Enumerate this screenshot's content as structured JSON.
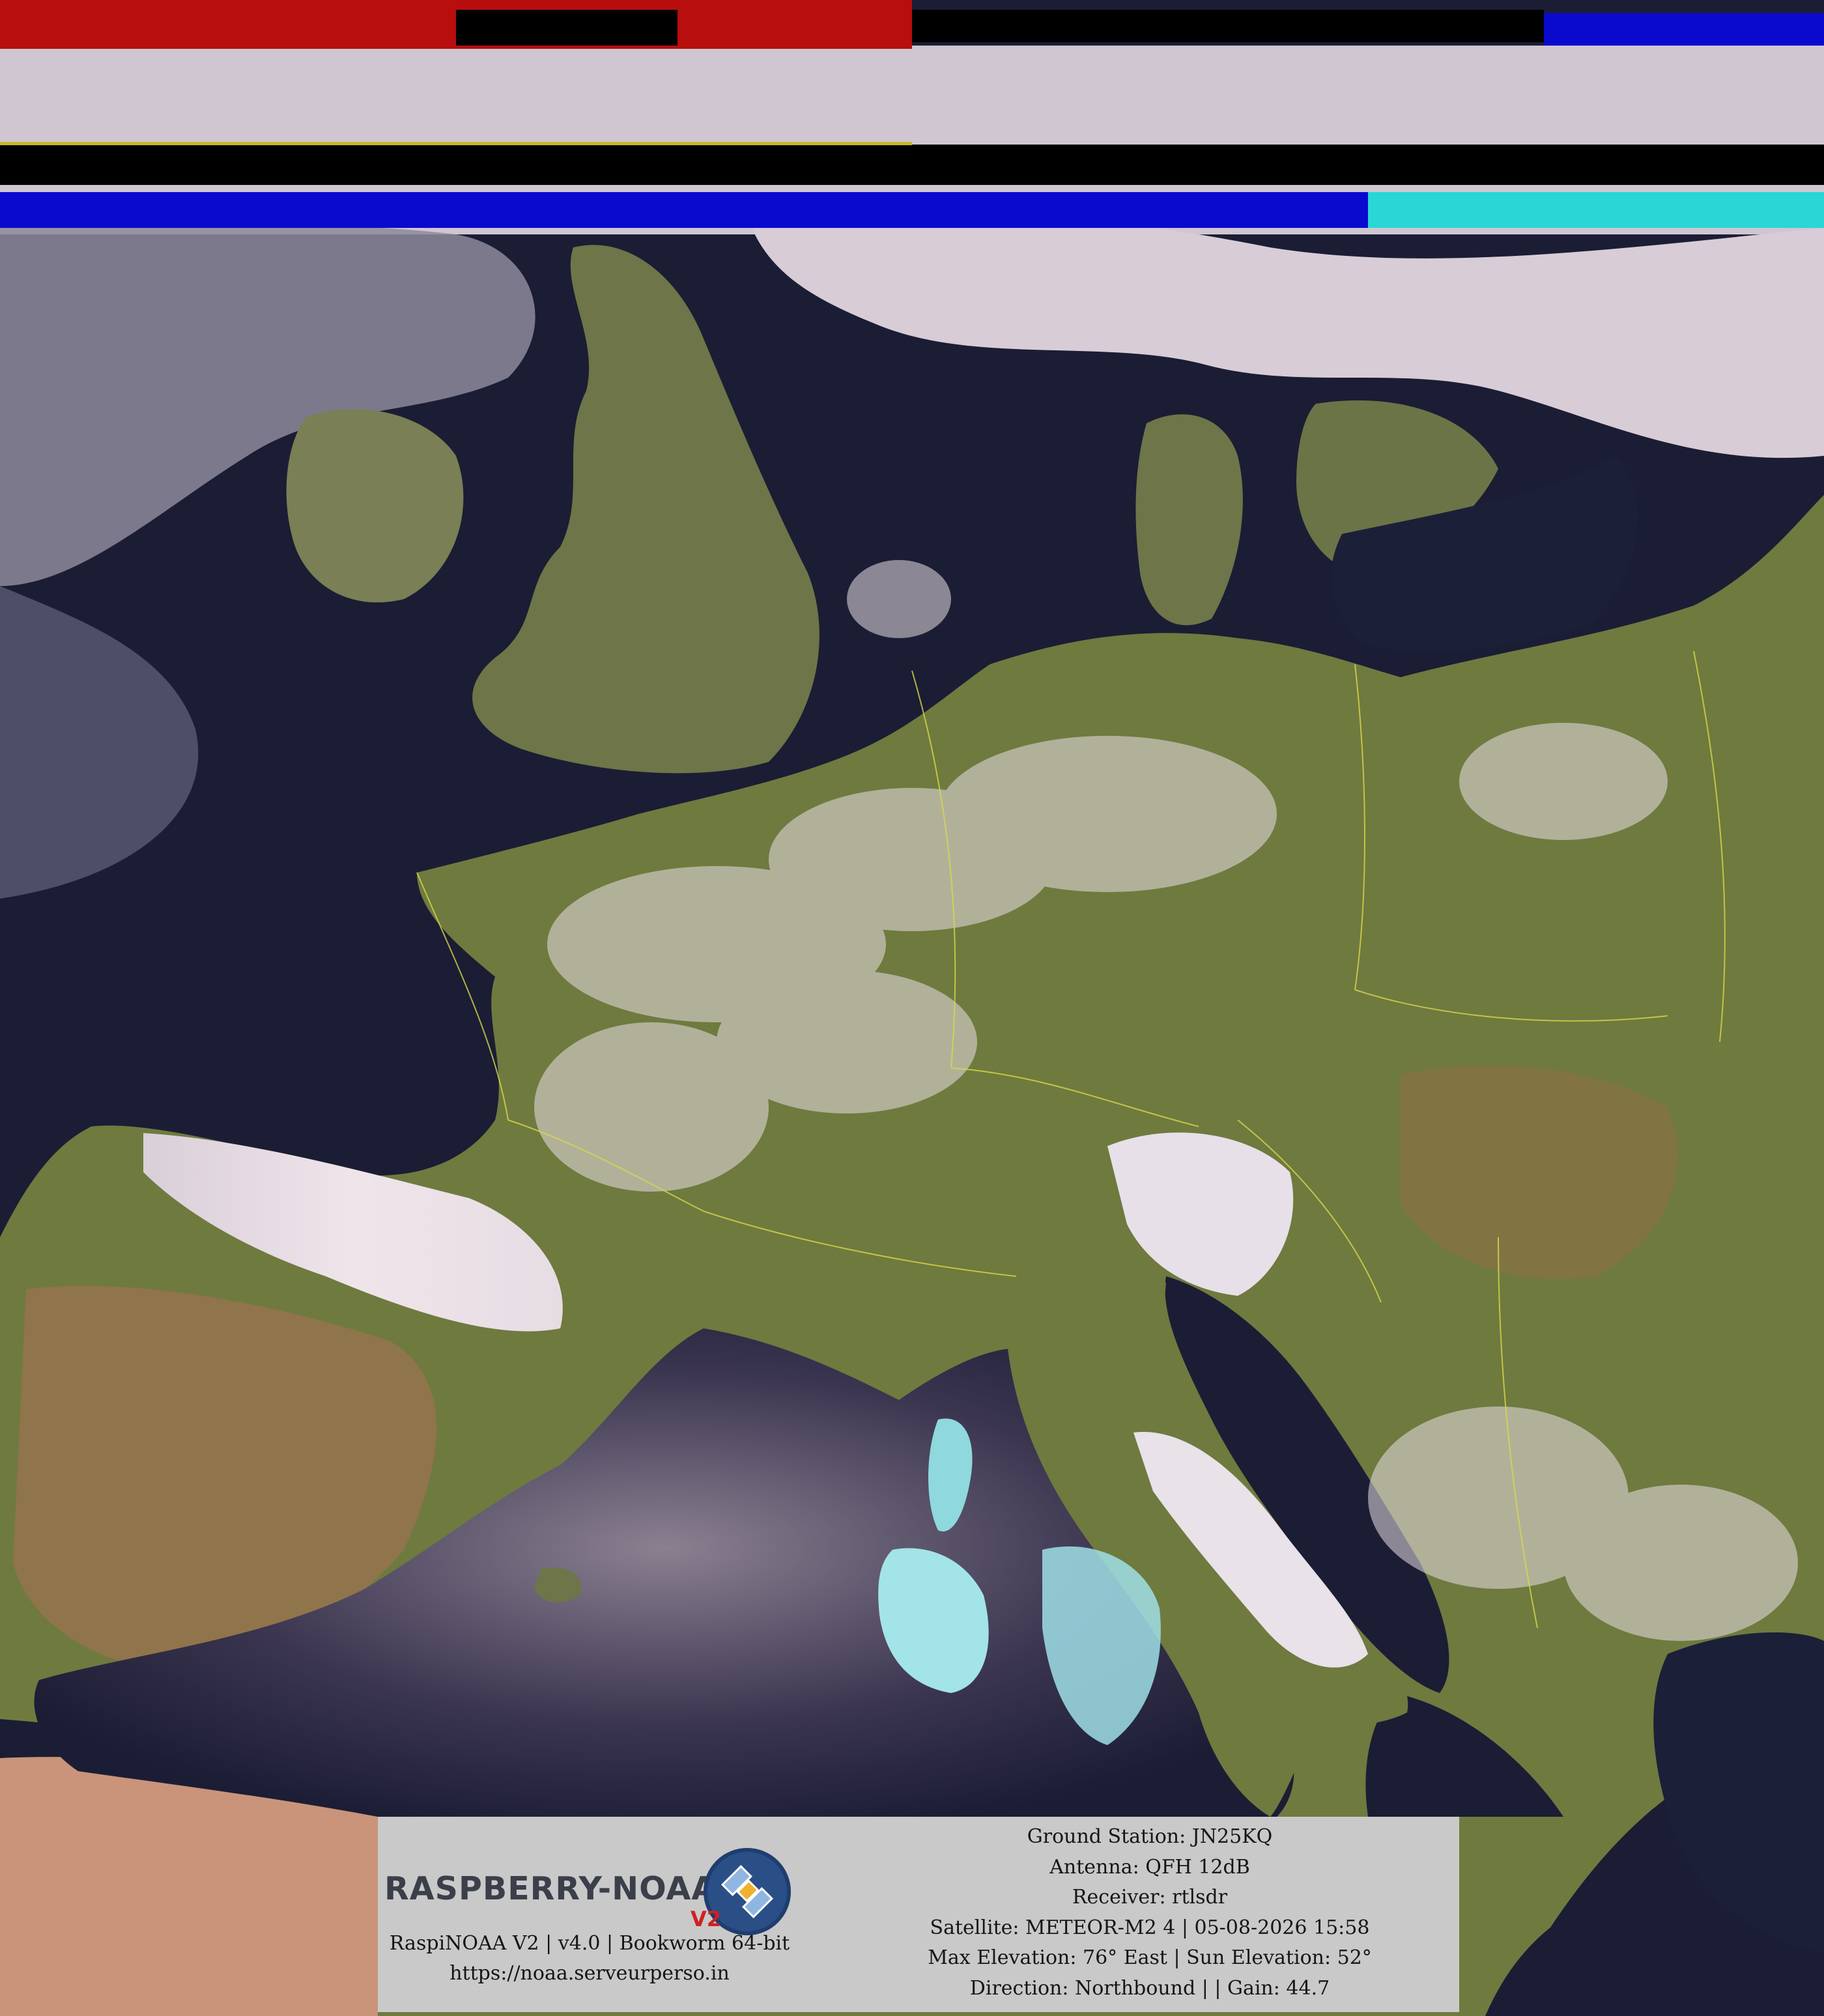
{
  "scene": {
    "description_colors": {
      "sea": "#1b1d34",
      "land_green": "#6b7a3d",
      "land_desert": "#c9947a",
      "cloud": "#e9dfe4",
      "cloud_ice": "#9ee7ec",
      "border_lines": "#d8d84a",
      "noise_red": "#c01010",
      "noise_blue": "#0a0acf",
      "noise_cyan": "#2ad6d6"
    }
  },
  "caption": {
    "logo_text": "RASPBERRY-NOAA",
    "logo_suffix": "V2",
    "software_line": "RaspiNOAA V2 | v4.0 | Bookworm 64-bit",
    "url": "https://noaa.serveurperso.in",
    "ground_station": "Ground Station: JN25KQ",
    "antenna": "Antenna: QFH 12dB",
    "receiver": "Receiver: rtlsdr",
    "satellite": "Satellite: METEOR-M2 4 | 05-08-2026 15:58",
    "elevation": "Max Elevation: 76° East | Sun Elevation: 52°",
    "direction": "Direction: Northbound | | Gain: 44.7"
  }
}
